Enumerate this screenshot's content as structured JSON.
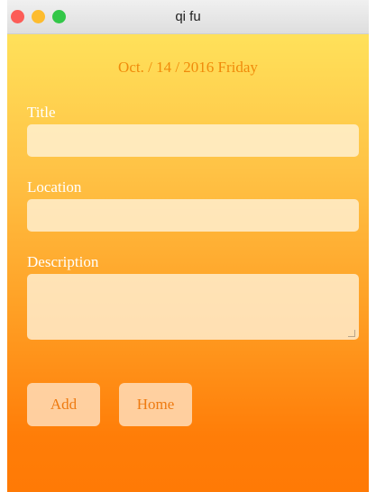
{
  "window": {
    "title": "qi fu",
    "controls": {
      "close": {
        "icon": "close-dot-icon",
        "color": "#fc5c57"
      },
      "minimize": {
        "icon": "minimize-dot-icon",
        "color": "#fdbc2e"
      },
      "maximize": {
        "icon": "maximize-dot-icon",
        "color": "#33c748"
      }
    }
  },
  "form": {
    "date": "Oct. / 14 / 2016 Friday",
    "title_label": "Title",
    "title_value": "",
    "location_label": "Location",
    "location_value": "",
    "description_label": "Description",
    "description_value": ""
  },
  "buttons": {
    "add_label": "Add",
    "home_label": "Home"
  },
  "colors": {
    "gradient_top": "#ffe15a",
    "gradient_bottom": "#ff7a05",
    "date_text": "#f08a0a",
    "button_text": "#ee7a10"
  }
}
